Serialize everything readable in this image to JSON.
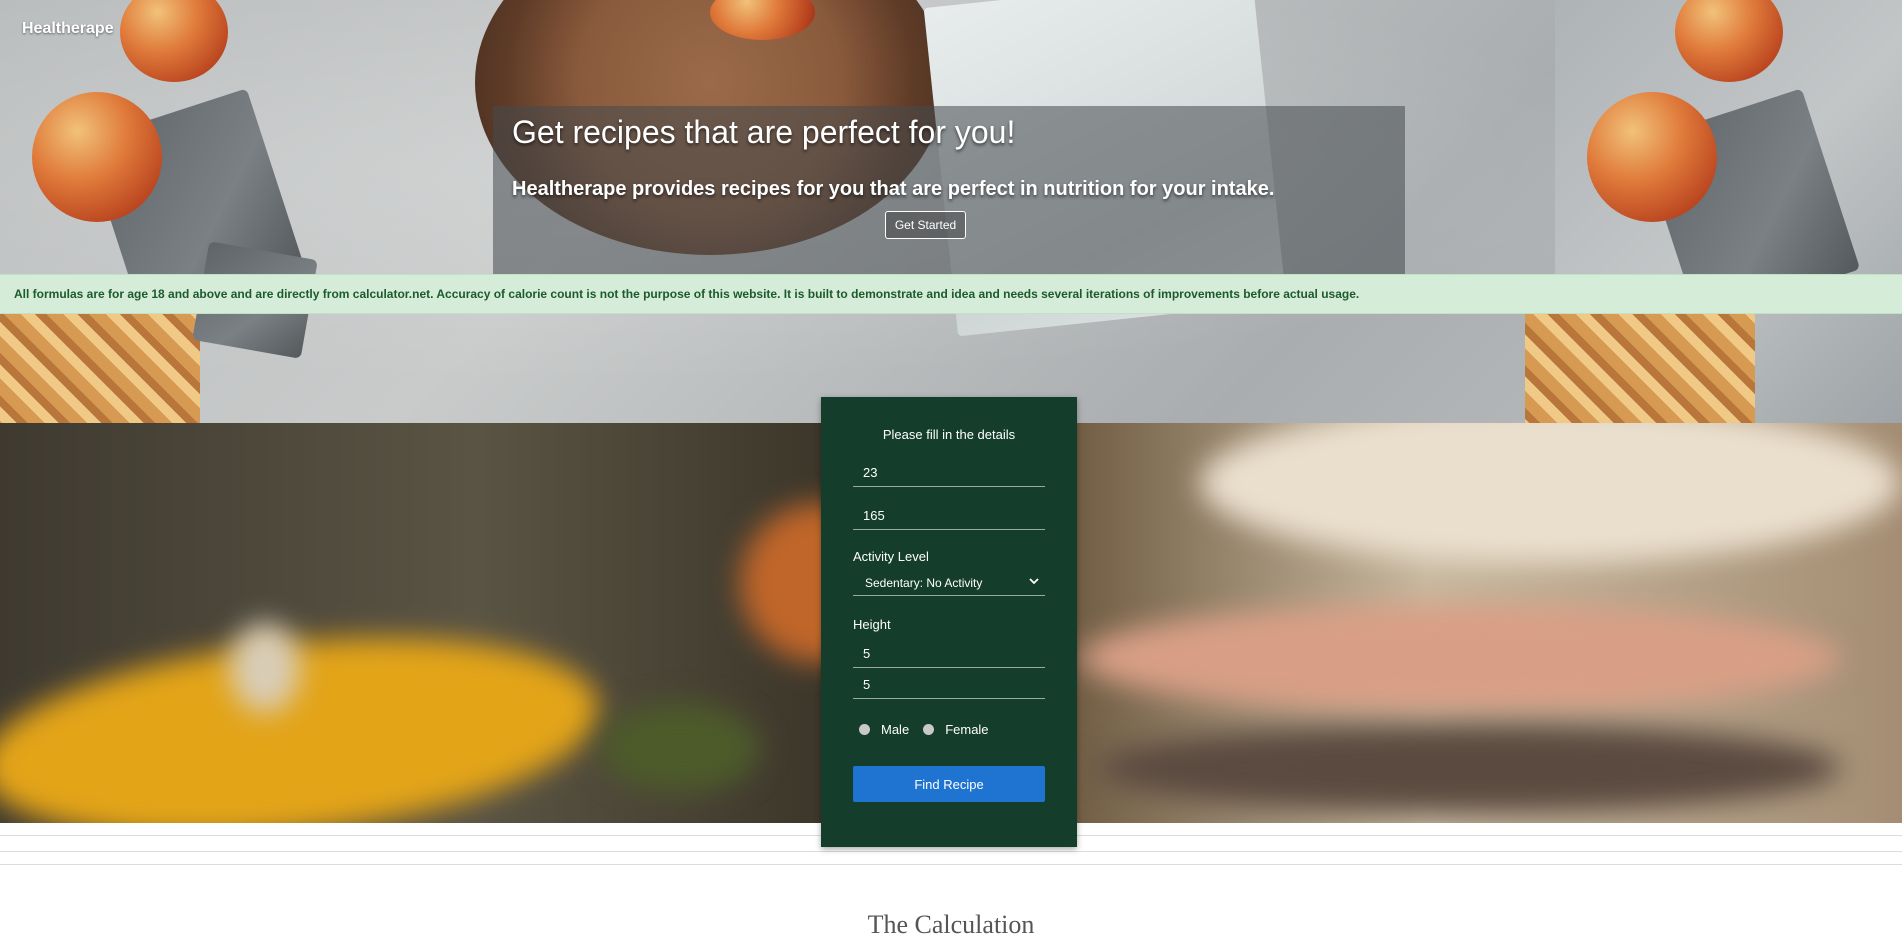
{
  "brand": {
    "name": "Healtherape"
  },
  "hero": {
    "title": "Get recipes that are perfect for you!",
    "subtitle": "Healtherape provides recipes for you that are perfect in nutrition for your intake.",
    "cta_label": "Get Started"
  },
  "alert": {
    "text": "All formulas are for age 18 and above and are directly from calculator.net. Accuracy of calorie count is not the purpose of this website. It is built to demonstrate and idea and needs several iterations of improvements before actual usage."
  },
  "form": {
    "title": "Please fill in the details",
    "age_value": "23",
    "weight_value": "165",
    "activity_label": "Activity Level",
    "activity_selected": "Sedentary: No Activity",
    "height_label": "Height",
    "height_feet_value": "5",
    "height_inches_value": "5",
    "gender_options": [
      "Male",
      "Female"
    ],
    "submit_label": "Find Recipe"
  },
  "sections": {
    "calculation_heading": "The Calculation"
  },
  "colors": {
    "card_bg": "#143d2c",
    "button_blue": "#1f73d1",
    "alert_bg": "#d5ecd9",
    "alert_text": "#1d5a2c"
  },
  "icons": {
    "select_chevron": "chevron-down-icon",
    "radio": "radio-unchecked-icon"
  }
}
